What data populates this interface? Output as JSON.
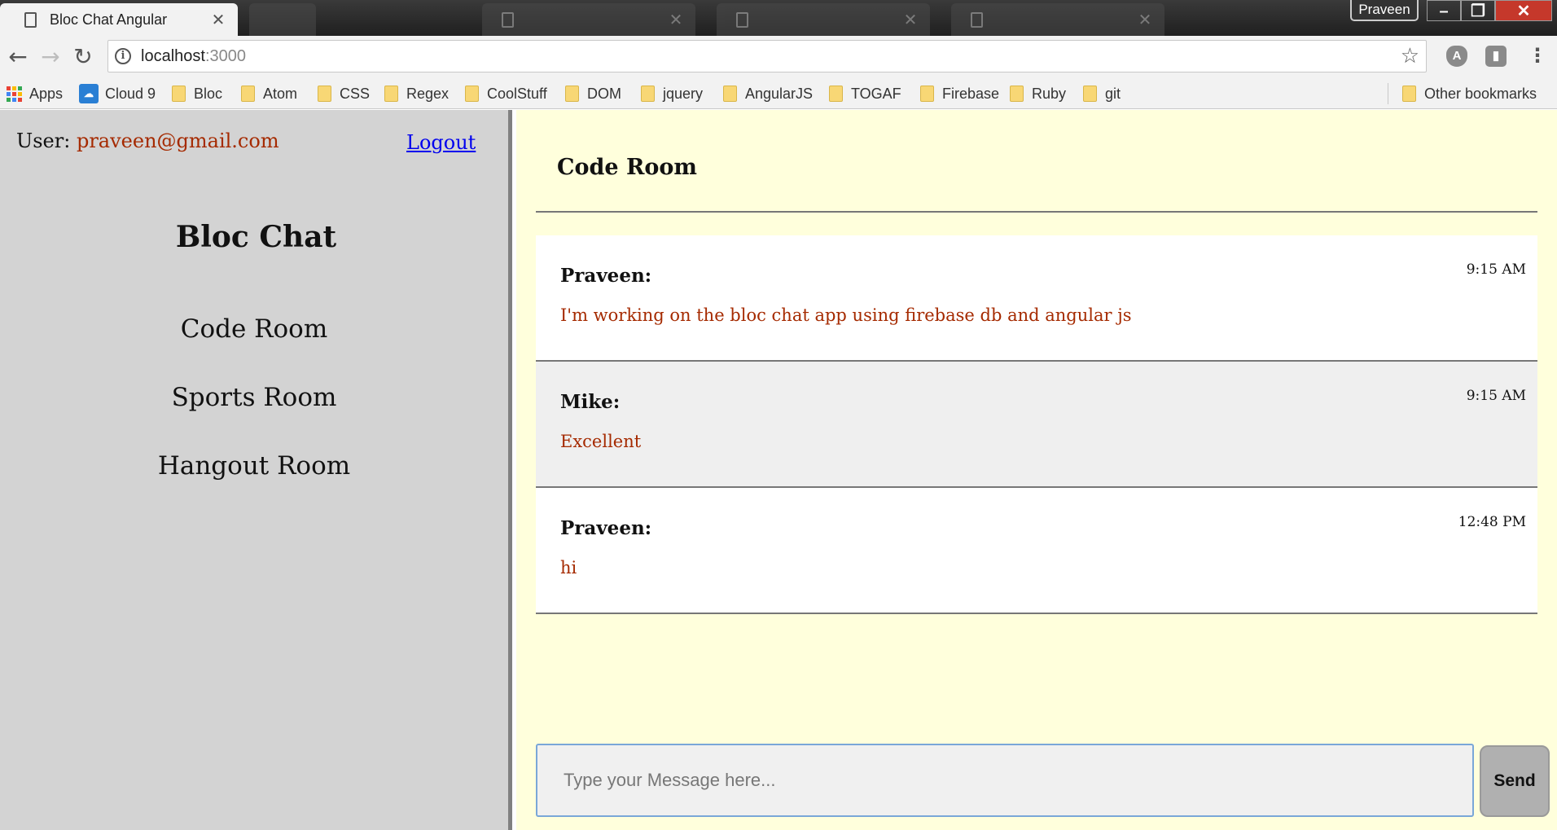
{
  "browser": {
    "tabs": [
      {
        "title": "Bloc Chat Angular",
        "active": true
      },
      {
        "title": "",
        "active": false
      },
      {
        "title": "",
        "active": false
      },
      {
        "title": "",
        "active": false
      },
      {
        "title": "",
        "active": false
      }
    ],
    "profile_name": "Praveen",
    "address": {
      "host": "localhost",
      "port": ":3000"
    },
    "bookmarks": [
      "Apps",
      "Cloud 9",
      "Bloc",
      "Atom",
      "CSS",
      "Regex",
      "CoolStuff",
      "DOM",
      "jquery",
      "AngularJS",
      "TOGAF",
      "Firebase",
      "Ruby",
      "git"
    ],
    "other_bookmarks": "Other bookmarks",
    "icons": {
      "back": "back-arrow-icon",
      "forward": "forward-arrow-icon",
      "reload": "reload-icon",
      "info": "info-icon",
      "star": "star-icon",
      "menu": "kebab-menu-icon"
    }
  },
  "sidebar": {
    "user_label": "User:",
    "user_email": "praveen@gmail.com",
    "logout_label": "Logout",
    "app_title": "Bloc Chat",
    "rooms": [
      {
        "name": "Code Room"
      },
      {
        "name": "Sports Room"
      },
      {
        "name": "Hangout Room"
      }
    ]
  },
  "chat": {
    "room_title": "Code Room",
    "messages": [
      {
        "user": "Praveen:",
        "time": "9:15 AM",
        "text": "I'm working on the bloc chat app using firebase db and angular js"
      },
      {
        "user": "Mike:",
        "time": "9:15 AM",
        "text": "Excellent"
      },
      {
        "user": "Praveen:",
        "time": "12:48 PM",
        "text": "hi"
      }
    ],
    "composer_placeholder": "Type your Message here...",
    "send_label": "Send"
  },
  "colors": {
    "sidebar_bg": "#d3d3d3",
    "chat_bg": "#ffffdc",
    "email_and_message_text": "#a52a00",
    "link": "#0000ee",
    "send_button_bg": "#b0b0b0"
  }
}
